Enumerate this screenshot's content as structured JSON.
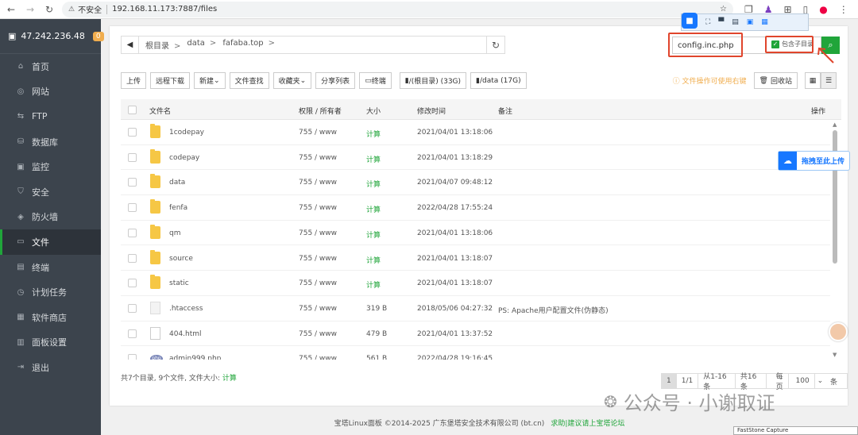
{
  "browser": {
    "security_label": "不安全",
    "url": "192.168.11.173:7887/files"
  },
  "sidebar": {
    "server_ip": "47.242.236.48",
    "badge": "0",
    "items": [
      {
        "label": "首页",
        "icon": "home-icon"
      },
      {
        "label": "网站",
        "icon": "globe-icon"
      },
      {
        "label": "FTP",
        "icon": "ftp-icon"
      },
      {
        "label": "数据库",
        "icon": "database-icon"
      },
      {
        "label": "监控",
        "icon": "monitor-icon"
      },
      {
        "label": "安全",
        "icon": "shield-icon"
      },
      {
        "label": "防火墙",
        "icon": "firewall-icon"
      },
      {
        "label": "文件",
        "icon": "folder-icon",
        "active": true
      },
      {
        "label": "终端",
        "icon": "terminal-icon"
      },
      {
        "label": "计划任务",
        "icon": "clock-icon"
      },
      {
        "label": "软件商店",
        "icon": "apps-icon"
      },
      {
        "label": "面板设置",
        "icon": "settings-icon"
      },
      {
        "label": "退出",
        "icon": "logout-icon"
      }
    ]
  },
  "path": {
    "crumbs": [
      "根目录",
      "data",
      "fafaba.top"
    ]
  },
  "search": {
    "value": "config.inc.php",
    "include_subdir_label": "包含子目录"
  },
  "toolbar": {
    "buttons": [
      "上传",
      "远程下载",
      "新建",
      "文件查找",
      "收藏夹",
      "分享列表",
      "终端",
      "/(根目录) (33G)",
      "/data (17G)"
    ],
    "hint": "文件操作可使用右键",
    "recycle": "回收站"
  },
  "table": {
    "headers": {
      "name": "文件名",
      "perm": "权限 / 所有者",
      "size": "大小",
      "mtime": "修改时间",
      "note": "备注",
      "action": "操作"
    },
    "rows": [
      {
        "name": "1codepay",
        "type": "folder",
        "perm": "755 / www",
        "size": "计算",
        "mtime": "2021/04/01 13:18:06",
        "note": ""
      },
      {
        "name": "codepay",
        "type": "folder",
        "perm": "755 / www",
        "size": "计算",
        "mtime": "2021/04/01 13:18:29",
        "note": ""
      },
      {
        "name": "data",
        "type": "folder",
        "perm": "755 / www",
        "size": "计算",
        "mtime": "2021/04/07 09:48:12",
        "note": ""
      },
      {
        "name": "fenfa",
        "type": "folder",
        "perm": "755 / www",
        "size": "计算",
        "mtime": "2022/04/28 17:55:24",
        "note": ""
      },
      {
        "name": "qm",
        "type": "folder",
        "perm": "755 / www",
        "size": "计算",
        "mtime": "2021/04/01 13:18:06",
        "note": ""
      },
      {
        "name": "source",
        "type": "folder",
        "perm": "755 / www",
        "size": "计算",
        "mtime": "2021/04/01 13:18:07",
        "note": ""
      },
      {
        "name": "static",
        "type": "folder",
        "perm": "755 / www",
        "size": "计算",
        "mtime": "2021/04/01 13:18:07",
        "note": ""
      },
      {
        "name": ".htaccess",
        "type": "file",
        "perm": "755 / www",
        "size": "319 B",
        "mtime": "2018/05/06 04:27:32",
        "note": "PS: Apache用户配置文件(伪静态)"
      },
      {
        "name": "404.html",
        "type": "html",
        "perm": "755 / www",
        "size": "479 B",
        "mtime": "2021/04/01 13:37:52",
        "note": ""
      },
      {
        "name": "admin999.php",
        "type": "php",
        "perm": "755 / www",
        "size": "561 B",
        "mtime": "2022/04/28 19:16:45",
        "note": ""
      }
    ]
  },
  "footer": {
    "summary_prefix": "共7个目录, 9个文件, 文件大小:",
    "summary_calc": "计算",
    "pager": {
      "current": "1",
      "total_pages": "1/1",
      "range": "从1-16条",
      "count": "共16条",
      "per_page_label": "每页",
      "per_page": "100",
      "unit": "条"
    }
  },
  "copyright": {
    "text": "宝塔Linux面板 ©2014-2025 广东堡塔安全技术有限公司 (bt.cn)",
    "link": "求助|建议请上宝塔论坛"
  },
  "overlay": {
    "upload_label": "拖拽至此上传",
    "watermark": "公众号 · 小谢取证",
    "faststone": "FastStone Capture"
  },
  "colors": {
    "accent": "#20a53a",
    "sidebar": "#3c444d",
    "highlight": "#e0452c"
  }
}
